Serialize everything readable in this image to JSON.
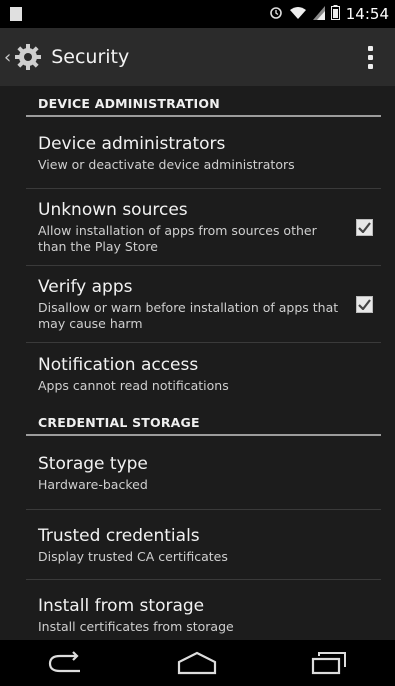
{
  "status_bar": {
    "time": "14:54"
  },
  "action_bar": {
    "title": "Security"
  },
  "sections": {
    "device_admin": {
      "header": "DEVICE ADMINISTRATION",
      "items": [
        {
          "title": "Device administrators",
          "subtitle": "View or deactivate device administrators"
        },
        {
          "title": "Unknown sources",
          "subtitle": "Allow installation of apps from sources other than the Play Store",
          "checked": true
        },
        {
          "title": "Verify apps",
          "subtitle": "Disallow or warn before installation of apps that may cause harm",
          "checked": true
        },
        {
          "title": "Notification access",
          "subtitle": "Apps cannot read notifications"
        }
      ]
    },
    "credential_storage": {
      "header": "CREDENTIAL STORAGE",
      "items": [
        {
          "title": "Storage type",
          "subtitle": "Hardware-backed"
        },
        {
          "title": "Trusted credentials",
          "subtitle": "Display trusted CA certificates"
        },
        {
          "title": "Install from storage",
          "subtitle": "Install certificates from storage"
        }
      ]
    }
  },
  "icons": {
    "status": [
      "notification-icon",
      "alarm-icon",
      "wifi-icon",
      "signal-icon",
      "battery-icon"
    ],
    "nav": [
      "back-icon",
      "home-icon",
      "recents-icon"
    ]
  }
}
